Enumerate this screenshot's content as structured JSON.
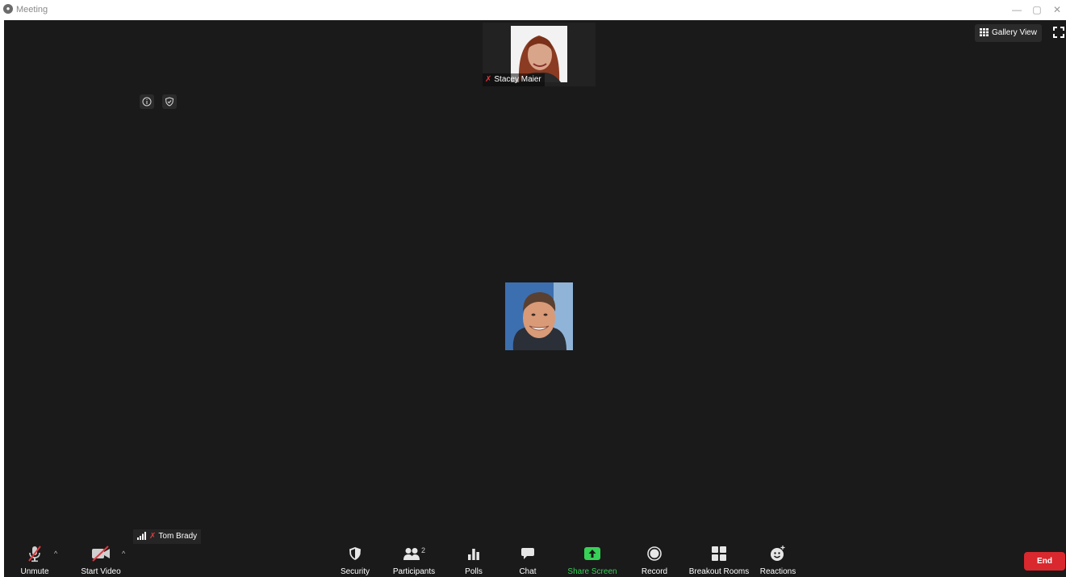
{
  "window": {
    "title": "Meeting",
    "controls": [
      "—",
      "▢",
      "✕"
    ]
  },
  "participants": {
    "top_thumbnail": {
      "name": "Stacey Maier",
      "muted": true
    },
    "self": {
      "name": "Tom Brady",
      "muted": true
    }
  },
  "view": {
    "gallery_label": "Gallery View"
  },
  "toolbar": {
    "unmute_label": "Unmute",
    "start_video_label": "Start Video",
    "security_label": "Security",
    "participants_label": "Participants",
    "participants_count": "2",
    "polls_label": "Polls",
    "chat_label": "Chat",
    "share_screen_label": "Share Screen",
    "record_label": "Record",
    "breakout_rooms_label": "Breakout Rooms",
    "reactions_label": "Reactions",
    "end_label": "End"
  },
  "colors": {
    "stage_bg": "#1a1a1a",
    "end_red": "#d9282e",
    "share_green": "#37d157",
    "mute_red": "#e0383e"
  }
}
